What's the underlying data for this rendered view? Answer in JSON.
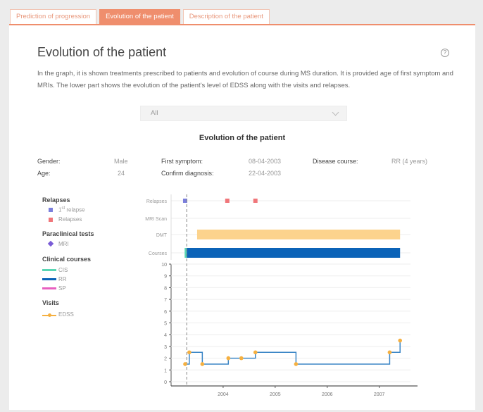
{
  "tabs": [
    {
      "label": "Prediction of progression"
    },
    {
      "label": "Evolution of the patient"
    },
    {
      "label": "Description of the patient"
    }
  ],
  "page": {
    "title": "Evolution of the patient",
    "help_icon": "question-circle-icon",
    "description": "In the graph, it is shown treatments prescribed to patients and evolution of course during MS duration. It is provided age of first symptom and MRIs. The lower part shows the evolution of the patient's level of EDSS along with the visits and relapses.",
    "select_value": "All",
    "chart_title": "Evolution of the patient"
  },
  "patient": {
    "gender_label": "Gender:",
    "gender": "Male",
    "age_label": "Age:",
    "age": "24",
    "first_symptom_label": "First symptom:",
    "first_symptom": "08-04-2003",
    "confirm_label": "Confirm diagnosis:",
    "confirm": "22-04-2003",
    "course_label": "Disease course:",
    "course": "RR (4 years)"
  },
  "legend": {
    "relapses_title": "Relapses",
    "first_relapse_prefix": "1",
    "first_relapse_sup": "st",
    "first_relapse_suffix": " relapse",
    "relapses": "Relapses",
    "paraclinical_title": "Paraclinical tests",
    "mri": "MRI",
    "clinical_title": "Clinical courses",
    "cis": "CIS",
    "rr": "RR",
    "sp": "SP",
    "visits_title": "Visits",
    "edss": "EDSS"
  },
  "colors": {
    "accent": "#ef8e6d",
    "first_relapse": "#7b7fdc",
    "relapse": "#f0767a",
    "mri": "#7a5cd6",
    "dmt": "#fcd38d",
    "cis": "#5ad6b3",
    "rr": "#0b63b8",
    "sp": "#e85fc0",
    "edss_line": "#3b86c6",
    "edss_point": "#f5b041"
  },
  "chart_data": {
    "type": "line",
    "timeline": {
      "row_labels": [
        "Relapses",
        "MRI Scan",
        "DMT",
        "Courses"
      ],
      "first_relapse": [
        2003.27
      ],
      "relapses": [
        2004.08,
        2004.62
      ],
      "dmt": {
        "start": 2003.5,
        "end": 2007.4
      },
      "cis": {
        "start": 2003.26,
        "end": 2003.3
      },
      "rr": {
        "start": 2003.3,
        "end": 2007.4
      }
    },
    "edss": {
      "x": [
        2003.27,
        2003.35,
        2003.6,
        2004.1,
        2004.35,
        2004.62,
        2005.4,
        2007.2,
        2007.4
      ],
      "y": [
        1.5,
        2.5,
        1.5,
        2.0,
        2.0,
        2.5,
        1.5,
        2.5,
        3.5
      ]
    },
    "diagnosis_x": 2003.3,
    "ylim": [
      0,
      10
    ],
    "yticks": [
      "0",
      "1",
      "2",
      "3",
      "4",
      "5",
      "6",
      "7",
      "8",
      "9",
      "10"
    ],
    "xlim": [
      2003.0,
      2007.6
    ],
    "xticks": [
      "2004",
      "2005",
      "2006",
      "2007"
    ]
  }
}
